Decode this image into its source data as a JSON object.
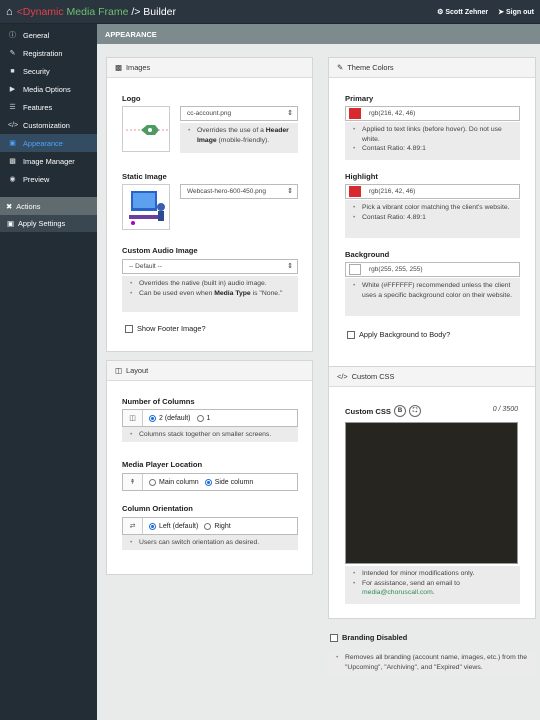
{
  "topbar": {
    "brand_lt": "<",
    "brand_dynamic": "Dynamic",
    "brand_media": " Media ",
    "brand_frame": "Frame",
    "brand_gt": " /> Builder",
    "user": "Scott Zehner",
    "signout": "Sign out"
  },
  "sidebar": {
    "items": [
      {
        "label": "General",
        "icon": "info-icon"
      },
      {
        "label": "Registration",
        "icon": "edit-icon"
      },
      {
        "label": "Security",
        "icon": "lock-icon"
      },
      {
        "label": "Media Options",
        "icon": "play-icon"
      },
      {
        "label": "Features",
        "icon": "list-icon"
      },
      {
        "label": "Customization",
        "icon": "code-icon"
      },
      {
        "label": "Appearance",
        "icon": "monitor-icon"
      },
      {
        "label": "Image Manager",
        "icon": "image-icon"
      },
      {
        "label": "Preview",
        "icon": "eye-icon"
      }
    ],
    "actions_label": "Actions",
    "apply_label": "Apply Settings"
  },
  "section_title": "APPEARANCE",
  "images": {
    "title": "Images",
    "logo_label": "Logo",
    "logo_value": "cc-account.png",
    "logo_hint_pre": "Overrides the use of a ",
    "logo_hint_bold": "Header Image",
    "logo_hint_post": " (mobile-friendly).",
    "static_label": "Static Image",
    "static_value": "Webcast-hero-600-450.png",
    "audio_label": "Custom Audio Image",
    "audio_value": "-- Default --",
    "audio_hint1": "Overrides the native (built in) audio image.",
    "audio_hint2_pre": "Can be used even when ",
    "audio_hint2_bold": "Media Type",
    "audio_hint2_post": " is \"None.\"",
    "footer_chk": "Show Footer Image?"
  },
  "layout": {
    "title": "Layout",
    "columns_label": "Number of Columns",
    "col_opt1": "2 (default)",
    "col_opt2": "1",
    "columns_hint": "Columns stack together on smaller screens.",
    "player_label": "Media Player Location",
    "player_opt1": "Main column",
    "player_opt2": "Side column",
    "orient_label": "Column Orientation",
    "orient_opt1": "Left (default)",
    "orient_opt2": "Right",
    "orient_hint": "Users can switch orientation as desired."
  },
  "theme": {
    "title": "Theme Colors",
    "primary_label": "Primary",
    "primary_value": "rgb(216, 42, 46)",
    "primary_color": "#d82a2e",
    "primary_hint1": "Applied to text links (before hover). Do not use white.",
    "primary_hint2": "Contast Ratio: 4.89:1",
    "highlight_label": "Highlight",
    "highlight_value": "rgb(216, 42, 46)",
    "highlight_color": "#d82a2e",
    "highlight_hint1": "Pick a vibrant color matching the client's website.",
    "highlight_hint2": "Contast Ratio: 4.89:1",
    "bg_label": "Background",
    "bg_value": "rgb(255, 255, 255)",
    "bg_color": "#ffffff",
    "bg_hint": "White (#FFFFFF) recommended unless the client uses a specific background color on their website.",
    "bg_chk": "Apply Background to Body?"
  },
  "css": {
    "title": "Custom CSS",
    "label": "Custom CSS",
    "counter": "0 / 3500",
    "hint1": "Intended for minor modifications only.",
    "hint2": "For assistance, send an email to",
    "email": "media@choruscall.com",
    "email_suffix": "."
  },
  "branding": {
    "chk": "Branding Disabled",
    "hint": "Removes all branding (account name, images, etc.) from the \"Upcoming\", \"Archiving\", and \"Expired\" views."
  }
}
